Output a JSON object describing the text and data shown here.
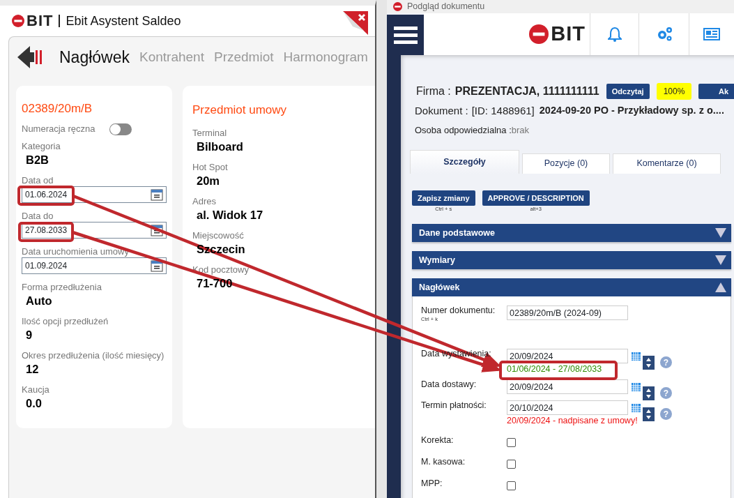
{
  "left_window": {
    "logo_text": "BIT",
    "title": "Ebit Asystent Saldeo",
    "tabs": [
      {
        "label": "Nagłówek",
        "selected": true
      },
      {
        "label": "Kontrahent",
        "selected": false
      },
      {
        "label": "Przedmiot",
        "selected": false
      },
      {
        "label": "Harmonogram",
        "selected": false
      }
    ],
    "contract_card": {
      "number": "02389/20m/B",
      "manual_numbering": {
        "label": "Numeracja ręczna",
        "on": false
      },
      "fields": [
        {
          "kind": "value",
          "label": "Kategoria",
          "value": "B2B"
        },
        {
          "kind": "date",
          "label": "Data od",
          "value": "01.06.2024"
        },
        {
          "kind": "date",
          "label": "Data do",
          "value": "27.08.2033"
        },
        {
          "kind": "date",
          "label": "Data uruchomienia umowy",
          "value": "01.09.2024"
        },
        {
          "kind": "value",
          "label": "Forma przedłużenia",
          "value": "Auto"
        },
        {
          "kind": "value",
          "label": "Ilość opcji przedłużeń",
          "value": "9"
        },
        {
          "kind": "value",
          "label": "Okres przedłużenia (ilość miesięcy)",
          "value": "12"
        },
        {
          "kind": "value",
          "label": "Kaucja",
          "value": "0.0"
        }
      ]
    },
    "subject_card": {
      "title": "Przedmiot umowy",
      "fields": [
        {
          "kind": "value",
          "label": "Terminal",
          "value": "Bilboard"
        },
        {
          "kind": "value",
          "label": "Hot Spot",
          "value": "20m"
        },
        {
          "kind": "value",
          "label": "Adres",
          "value": "al. Widok 17"
        },
        {
          "kind": "value",
          "label": "Miejscowość",
          "value": "Szczecin"
        },
        {
          "kind": "value",
          "label": "Kod pocztowy",
          "value": "71-700"
        }
      ]
    }
  },
  "right_window": {
    "title": "Podgląd dokumentu",
    "logo_text": "BIT",
    "firma": {
      "label": "Firma :",
      "value": "PREZENTACJA, 1111111111"
    },
    "read_button": "Odczytaj",
    "percent": "100%",
    "cut_button": "Ak",
    "document": {
      "label": "Dokument :",
      "id": "[ID: 1488961]",
      "name": "2024-09-20 PO - Przykładowy sp. z o...."
    },
    "responsible": {
      "label": "Osoba odpowiedzialna :",
      "value": "brak"
    },
    "tabs": [
      {
        "label": "Szczegóły",
        "selected": true
      },
      {
        "label": "Pozycje (0)",
        "selected": false
      },
      {
        "label": "Komentarze (0)",
        "selected": false
      }
    ],
    "actions": [
      {
        "label": "Zapisz zmiany",
        "shortcut": "Ctrl + s"
      },
      {
        "label": "APPROVE / DESCRIPTION",
        "shortcut": "alt+3"
      }
    ],
    "sections": [
      {
        "title": "Dane podstawowe",
        "expanded": false
      },
      {
        "title": "Wymiary",
        "expanded": false
      },
      {
        "title": "Nagłówek",
        "expanded": true,
        "rows": [
          {
            "kind": "text",
            "label": "Numer dokumentu:",
            "shortcut": "Ctrl + k",
            "value": "02389/20m/B (2024-09)"
          },
          {
            "kind": "date",
            "label": "Data wystawienia:",
            "value": "20/09/2024",
            "help": "?",
            "note": {
              "text": "01/06/2024 - 27/08/2033",
              "color": "#2e8b00"
            }
          },
          {
            "kind": "date",
            "label": "Data dostawy:",
            "value": "20/09/2024",
            "help": "?"
          },
          {
            "kind": "date",
            "label": "Termin płatności:",
            "value": "20/10/2024",
            "help": "?",
            "note": {
              "text": "20/09/2024 - nadpisane z umowy!",
              "color": "#ee1111"
            }
          },
          {
            "kind": "checkbox",
            "label": "Korekta:",
            "checked": false
          },
          {
            "kind": "checkbox",
            "label": "M. kasowa:",
            "checked": false
          },
          {
            "kind": "checkbox",
            "label": "MPP:",
            "checked": false
          }
        ]
      }
    ]
  }
}
